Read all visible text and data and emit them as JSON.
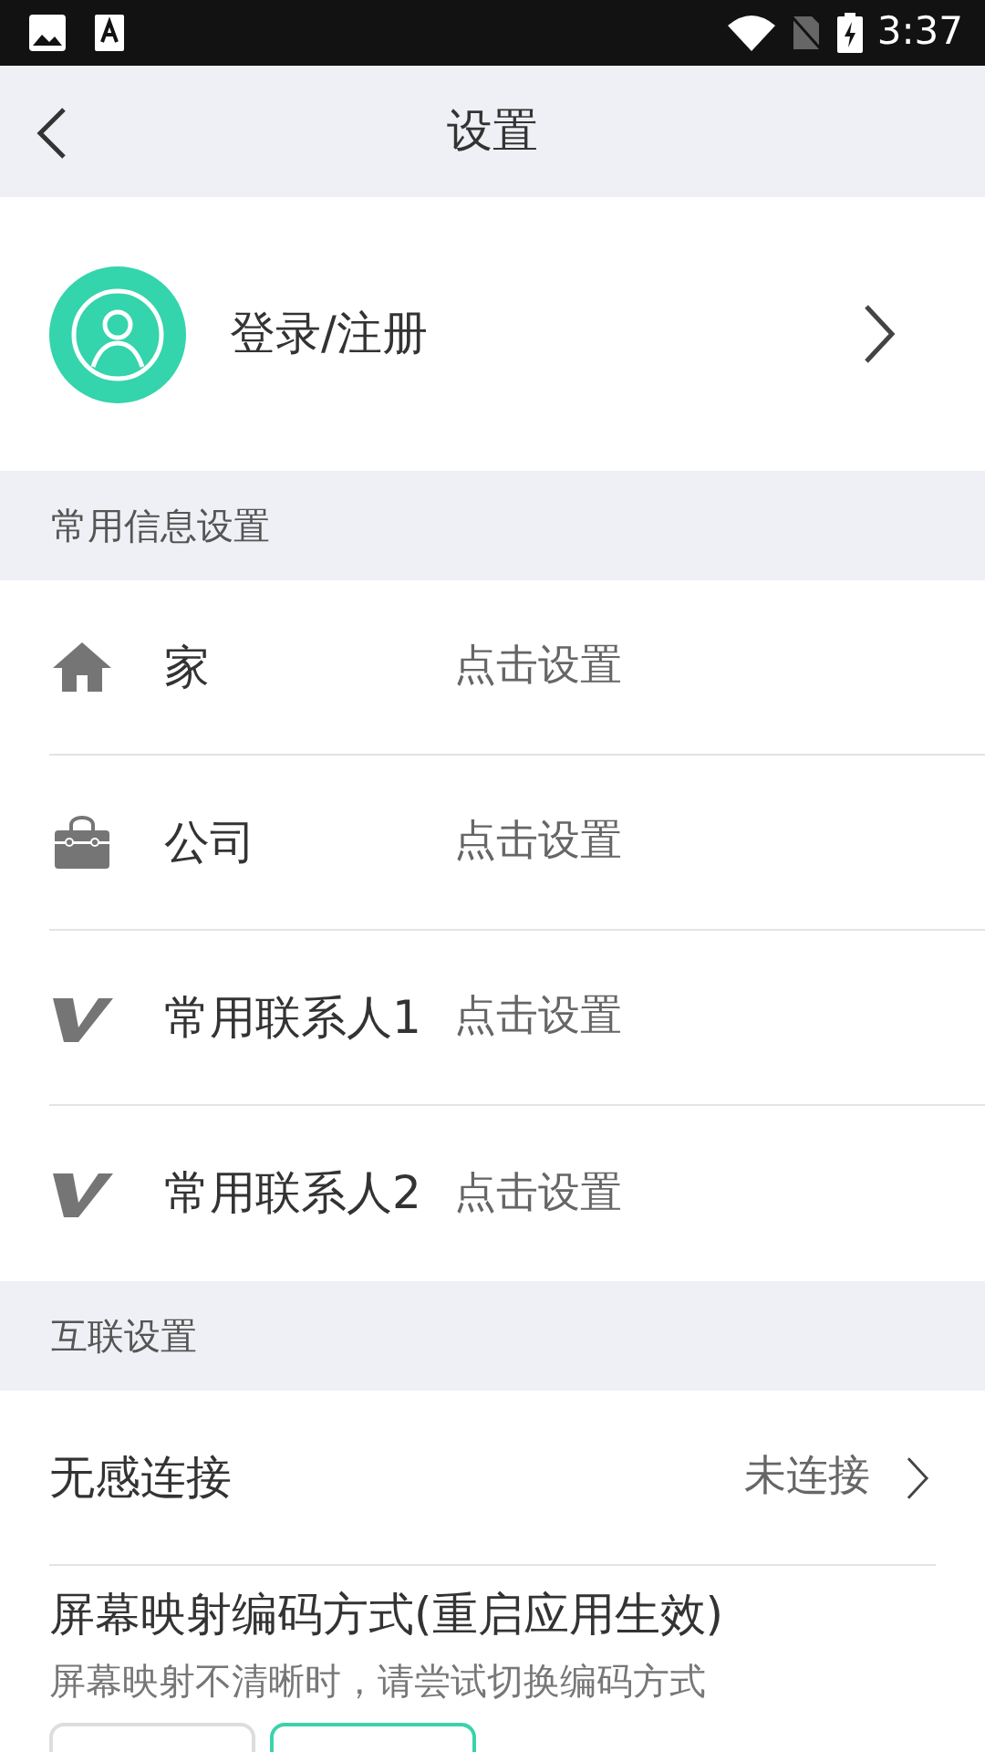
{
  "status_bar": {
    "time": "3:37"
  },
  "header": {
    "title": "设置"
  },
  "profile": {
    "label": "登录/注册"
  },
  "sections": [
    {
      "title": "常用信息设置",
      "items": [
        {
          "kind": "home",
          "label": "家",
          "value": "点击设置"
        },
        {
          "kind": "work",
          "label": "公司",
          "value": "点击设置"
        },
        {
          "kind": "contact",
          "label": "常用联系人1",
          "value": "点击设置"
        },
        {
          "kind": "contact",
          "label": "常用联系人2",
          "value": "点击设置"
        }
      ]
    },
    {
      "title": "互联设置",
      "items": [
        {
          "kind": "link",
          "label": "无感连接",
          "value": "未连接"
        }
      ]
    }
  ],
  "encoding": {
    "title": "屏幕映射编码方式(重启应用生效)",
    "hint": "屏幕映射不清晰时，请尝试切换编码方式",
    "options": [
      {
        "selected": false
      },
      {
        "selected": true
      }
    ]
  }
}
